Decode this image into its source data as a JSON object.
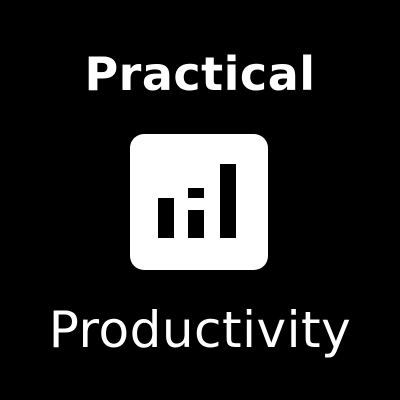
{
  "logo": {
    "line_top": "Practical",
    "line_bottom": "Productivity",
    "icon": "bar-chart-ascending-icon",
    "colors": {
      "background": "#000000",
      "foreground": "#ffffff"
    }
  }
}
